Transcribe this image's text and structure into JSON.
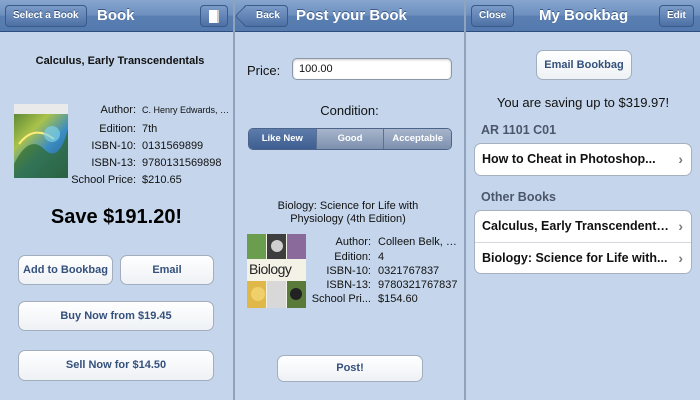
{
  "left_panel": {
    "nav": {
      "button": "Select a Book",
      "title": "Book",
      "icon": "document-icon"
    },
    "book_title": "Calculus, Early Transcendentals",
    "details": [
      {
        "key": "Author:",
        "value": "C. Henry Edwards, Da..."
      },
      {
        "key": "Edition:",
        "value": "7th"
      },
      {
        "key": "ISBN-10:",
        "value": "0131569899"
      },
      {
        "key": "ISBN-13:",
        "value": "9780131569898"
      },
      {
        "key": "School Price:",
        "value": "$210.65"
      }
    ],
    "save_text": "Save $191.20!",
    "buttons": {
      "add": "Add to Bookbag",
      "email": "Email",
      "buy": "Buy Now from $19.45",
      "sell": "Sell Now for $14.50"
    }
  },
  "middle_panel": {
    "nav": {
      "back": "Back",
      "title": "Post your Book"
    },
    "price_label": "Price:",
    "price_value": "100.00",
    "condition_label": "Condition:",
    "conditions": [
      "Like New",
      "Good",
      "Acceptable"
    ],
    "selected_condition": "Like New",
    "book_title": "Biology: Science for Life with Physiology (4th Edition)",
    "cover_word": "Biology",
    "details": [
      {
        "key": "Author:",
        "value": "Colleen Belk, Vir..."
      },
      {
        "key": "Edition:",
        "value": "4"
      },
      {
        "key": "ISBN-10:",
        "value": "0321767837"
      },
      {
        "key": "ISBN-13:",
        "value": "9780321767837"
      },
      {
        "key": "School Pri...",
        "value": "$154.60"
      }
    ],
    "post_button": "Post!"
  },
  "right_panel": {
    "nav": {
      "close": "Close",
      "title": "My Bookbag",
      "edit": "Edit"
    },
    "email_button": "Email Bookbag",
    "saving_text": "You are saving up to $319.97!",
    "section1": {
      "header": "AR 1101 C01",
      "items": [
        "How to Cheat in Photoshop..."
      ]
    },
    "section2": {
      "header": "Other Books",
      "items": [
        "Calculus, Early Transcendentals",
        "Biology: Science for Life with..."
      ]
    }
  },
  "colors": {
    "nav_bar": "#5a7fb2",
    "background": "#c5d6ec",
    "button_text": "#34507c"
  }
}
